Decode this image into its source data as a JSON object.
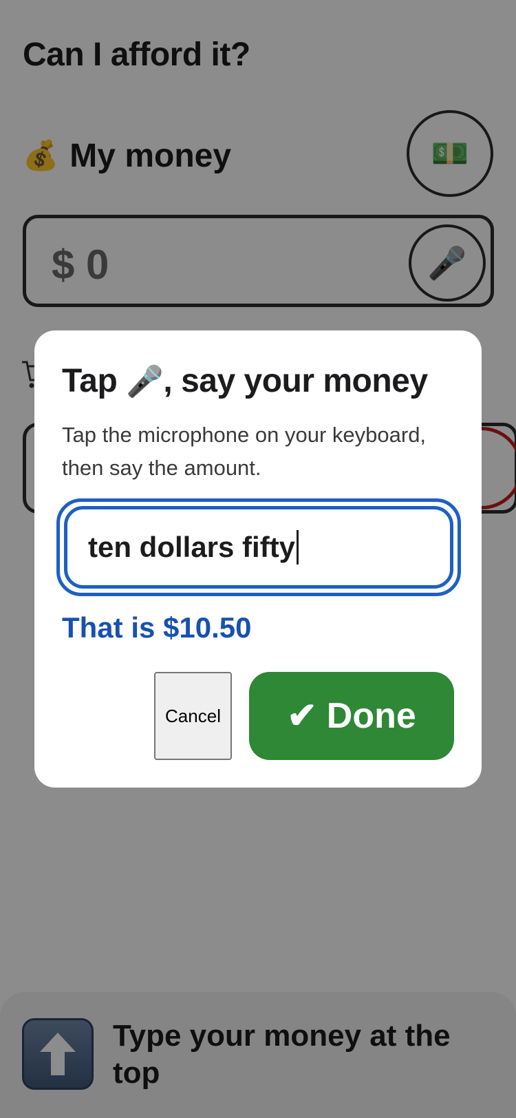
{
  "app": {
    "title": "Can I afford it?"
  },
  "money": {
    "header_icon": "money-bag",
    "header_icon_glyph": "💰",
    "header_label": "My money",
    "bill_icon": "dollar-bill",
    "bill_icon_glyph": "💵",
    "currency_symbol": "$",
    "value": "0",
    "mic_icon": "microphone",
    "mic_icon_glyph": "🎤"
  },
  "hint": {
    "icon": "up-arrow",
    "text": "Type your money at the top"
  },
  "dialog": {
    "title_prefix": "Tap ",
    "title_icon": "microphone",
    "title_icon_glyph": "🎤",
    "title_suffix": ", say your money",
    "description": "Tap the microphone on your keyboard, then say the amount.",
    "speech_input_value": "ten dollars fifty",
    "converted_text": "That is $10.50",
    "cancel_label": "Cancel",
    "done_check": "✔",
    "done_label": "Done"
  },
  "colors": {
    "accent_blue": "#1d60c4",
    "converted_blue": "#1751b0",
    "done_green": "#2e8836",
    "overlay": "rgba(0,0,0,0.45)"
  }
}
